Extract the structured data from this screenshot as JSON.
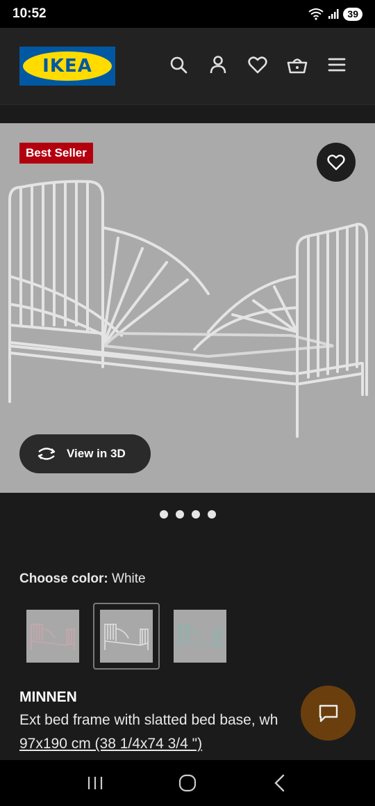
{
  "status_bar": {
    "time": "10:52",
    "battery": "39",
    "icons": [
      "wifi-icon",
      "signal-icon",
      "battery-icon"
    ]
  },
  "header": {
    "logo_text": "IKEA",
    "icons": [
      "search-icon",
      "account-icon",
      "wishlist-icon",
      "basket-icon",
      "menu-icon"
    ]
  },
  "hero": {
    "badge": "Best Seller",
    "favorite_icon": "heart-icon",
    "view_3d_label": "View in 3D",
    "view_3d_icon": "rotate-icon",
    "image_count": 4,
    "active_image": 0
  },
  "color_chooser": {
    "label": "Choose color:",
    "selected": "White",
    "options": [
      {
        "name": "Pink",
        "tint": "#c7a7ad",
        "selected": false
      },
      {
        "name": "White",
        "tint": "#cfcfcf",
        "selected": true
      },
      {
        "name": "Turquoise",
        "tint": "#8fb2ae",
        "selected": false
      }
    ]
  },
  "product": {
    "name": "MINNEN",
    "description": "Ext bed frame with slatted bed base, wh",
    "size": "97x190 cm (38 1/4x74 3/4 \")"
  },
  "colors": {
    "background": "#1b1b1b",
    "header_bg": "#222222",
    "badge_red": "#b3000f",
    "ikea_blue": "#0058a3",
    "ikea_yellow": "#ffdb00",
    "chat_button": "#6a3f0d"
  },
  "nav_bar": {
    "icons": [
      "recents-icon",
      "home-icon",
      "back-icon"
    ]
  }
}
